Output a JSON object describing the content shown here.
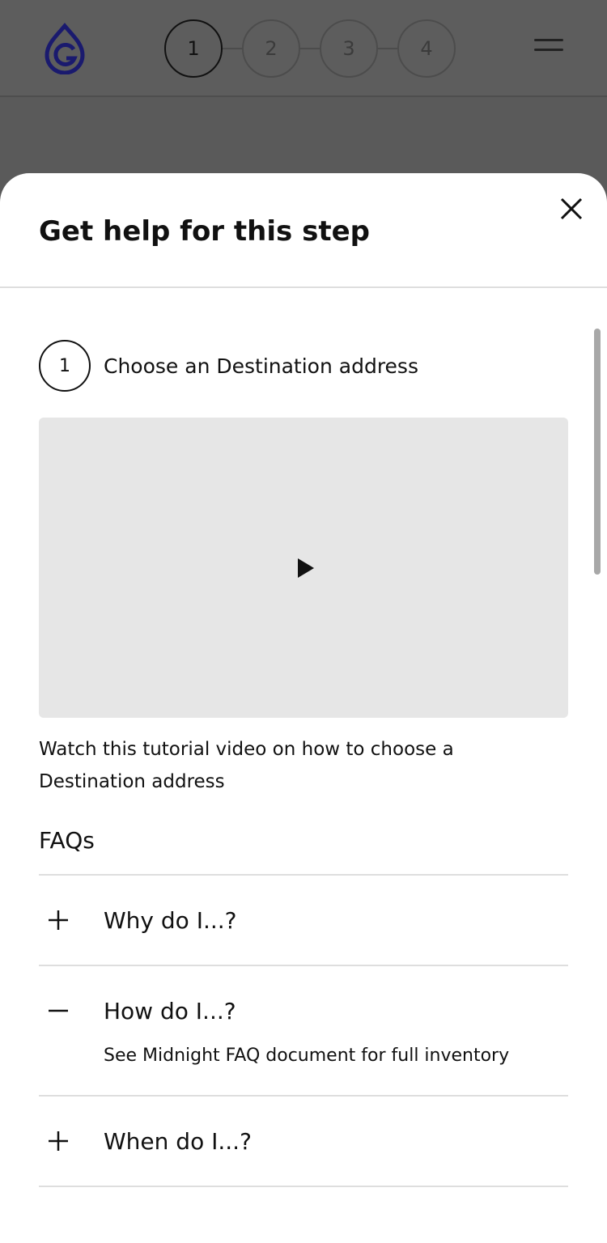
{
  "header": {
    "logo_icon": "g-drop-logo-icon",
    "steps": [
      "1",
      "2",
      "3",
      "4"
    ],
    "active_step": 1,
    "menu_icon": "hamburger-menu-icon"
  },
  "sheet": {
    "title": "Get help for this step",
    "close_icon": "close-icon",
    "step_number": "1",
    "step_label": "Choose an Destination address",
    "video_play_icon": "play-icon",
    "video_description": "Watch this tutorial video on how to choose a Destination address",
    "faqs_heading": "FAQs",
    "faqs": [
      {
        "question": "Why do I...?",
        "expanded": false,
        "answer": ""
      },
      {
        "question": "How do I...?",
        "expanded": true,
        "answer": "See Midnight FAQ document for full inventory"
      },
      {
        "question": "When do I...?",
        "expanded": false,
        "answer": ""
      }
    ]
  },
  "colors": {
    "overlay": "#5d5d5d",
    "logo": "#1a1a6e",
    "sheet_bg": "#ffffff",
    "video_bg": "#e6e6e6",
    "divider": "#dedede"
  }
}
